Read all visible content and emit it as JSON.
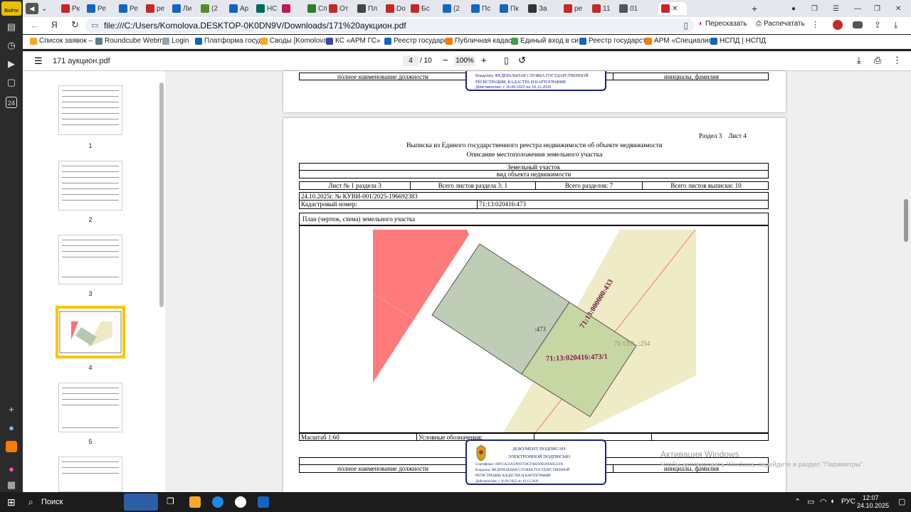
{
  "browser": {
    "tabs": [
      {
        "label": "Рк",
        "color": "#c62828"
      },
      {
        "label": "Ре",
        "color": "#1565c0"
      },
      {
        "label": "Ре",
        "color": "#1565c0"
      },
      {
        "label": "ре",
        "color": "#c62828"
      },
      {
        "label": "Ли",
        "color": "#1565c0"
      },
      {
        "label": "(2",
        "color": "#558b2f"
      },
      {
        "label": "Ар",
        "color": "#1565c0"
      },
      {
        "label": "НС",
        "color": "#00695c"
      },
      {
        "label": "",
        "color": "#c2185b"
      },
      {
        "label": "Сп",
        "color": "#2e7d32"
      },
      {
        "label": "От",
        "color": "#c62828"
      },
      {
        "label": "Пл",
        "color": "#444444"
      },
      {
        "label": "Do",
        "color": "#c62828"
      },
      {
        "label": "Бс",
        "color": "#c62828"
      },
      {
        "label": "(2",
        "color": "#1565c0"
      },
      {
        "label": "Пс",
        "color": "#1565c0"
      },
      {
        "label": "Пк",
        "color": "#1565c0"
      },
      {
        "label": "За",
        "color": "#333333"
      },
      {
        "label": "ре",
        "color": "#c62828"
      },
      {
        "label": "11",
        "color": "#c62828"
      },
      {
        "label": "01",
        "color": "#555555"
      }
    ],
    "url": "file:///C:/Users/Komolova.DESKTOP-0K0DN9V/Downloads/171%20аукцион.pdf",
    "retell_label": "Пересказать",
    "print_label": "Распечатать",
    "bookmarks": [
      {
        "label": "Список заявок –",
        "color": "#f9a825"
      },
      {
        "label": "Roundcube Webm",
        "color": "#607d8b"
      },
      {
        "label": "Login",
        "color": "#90a4ae"
      },
      {
        "label": "Платформа госуд",
        "color": "#1565c0"
      },
      {
        "label": "Своды [Komolova",
        "color": "#f9a825"
      },
      {
        "label": "КС «АРМ ГС»",
        "color": "#3949ab"
      },
      {
        "label": "Реестр государст",
        "color": "#1565c0"
      },
      {
        "label": "Публичная кадас",
        "color": "#f57c00"
      },
      {
        "label": "Единый вход в си",
        "color": "#43a047"
      },
      {
        "label": "Реестр государст",
        "color": "#1565c0"
      },
      {
        "label": "АРМ «Специалис",
        "color": "#f57c00"
      },
      {
        "label": "НСПД | НСПД",
        "color": "#1565c0"
      }
    ]
  },
  "pdf": {
    "filename": "171 аукцион.pdf",
    "page_current": "4",
    "page_total": "/ 10",
    "zoom": "100%",
    "thumbs": [
      "1",
      "2",
      "3",
      "4",
      "5"
    ]
  },
  "doc": {
    "prev_position_label": "полное наименование должности",
    "prev_initials_label": "инициалы, фамилия",
    "section_header": "Раздел 3    Лист 4",
    "title": "Выписка из Единого государственного реестра недвижимости об объекте недвижимости",
    "subtitle": "Описание местоположения земельного участка",
    "object_type": "Земельный участок",
    "object_type_caption": "вид объекта недвижимости",
    "sheet_info": [
      "Лист № 1 раздела 3",
      "Всего листов раздела 3: 1",
      "Всего разделов: 7",
      "Всего листов выписки: 10"
    ],
    "date_number": "24.10.2025г. № КУВИ-001/2025-196692383",
    "cadastral_label": "Кадастровый номер:",
    "cadastral_value": "71:13:020416:473",
    "plan_label": "План (чертеж, схема) земельного участка",
    "map_labels": {
      "parcel": ":473",
      "sub_parcel": "71:13:020416:473/1",
      "road": "71:13:000000:433",
      "neighbor": "71:13:0...:254",
      "corner": "..."
    },
    "scale_label": "Масштаб 1:60",
    "legend_label": "Условные обозначения:",
    "position_label": "полное наименование должности",
    "initials_label": "инициалы, фамилия",
    "stamp": {
      "line1": "ДОКУМЕНТ ПОДПИСАН",
      "line2": "ЭЛЕКТРОННОЙ ПОДПИСЬЮ",
      "cert": "Сертификат: 00915A25A59993758CT66D39D20FA0525FA",
      "owner": "Владелец: ФЕДЕРАЛЬНАЯ СЛУЖБА ГОСУДАРСТВЕННОЙ",
      "owner2": "РЕГИСТРАЦИИ, КАДАСТРА И КАРТОГРАФИИ",
      "valid": "Действителен: с 16.09.2025 по 10.12.2026"
    }
  },
  "watermark": {
    "title": "Активация Windows",
    "text": "Чтобы активировать Windows, перейдите в раздел \"Параметры\"."
  },
  "taskbar": {
    "search_label": "Поиск",
    "lang": "РУС",
    "time": "12:07",
    "date": "24.10.2025"
  },
  "sidebar": {
    "login_label": "Войти",
    "badge": "24"
  }
}
